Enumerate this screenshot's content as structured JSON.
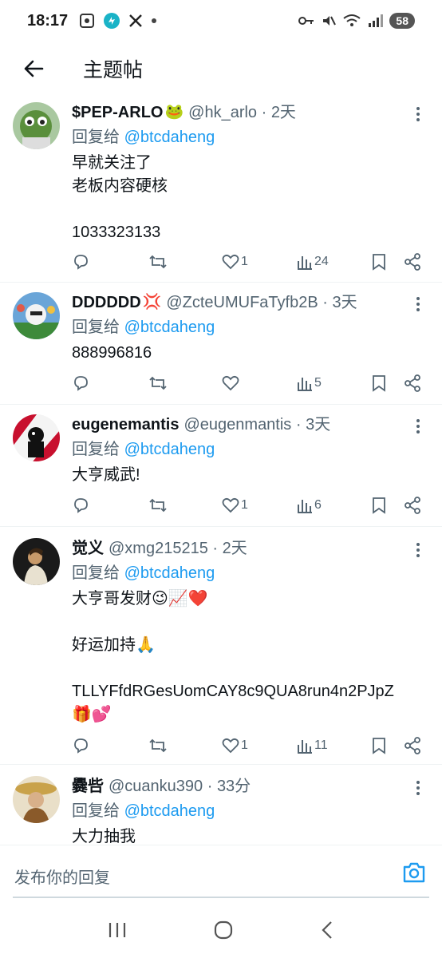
{
  "status_bar": {
    "time": "18:17",
    "battery": "58"
  },
  "app_bar": {
    "title": "主题帖"
  },
  "tweets": [
    {
      "name": "$PEP-ARLO",
      "emoji": "🐸",
      "meta": "@hk_arlo · 2天",
      "reply_prefix": "回复给",
      "reply_mention": "@btcdaheng",
      "body": "早就关注了\n老板内容硬核\n\n1033323133",
      "likes": "1",
      "views": "24"
    },
    {
      "name": "DDDDDD",
      "emoji": "💢",
      "meta": "@ZcteUMUFaTyfb2B · 3天",
      "reply_prefix": "回复给",
      "reply_mention": "@btcdaheng",
      "body": "888996816",
      "likes": "",
      "views": "5"
    },
    {
      "name": "eugenemantis",
      "emoji": "",
      "meta": "@eugenmantis · 3天",
      "reply_prefix": "回复给",
      "reply_mention": "@btcdaheng",
      "body": "大亨威武!",
      "likes": "1",
      "views": "6"
    },
    {
      "name": "觉义",
      "emoji": "",
      "meta": "@xmg215215 · 2天",
      "reply_prefix": "回复给",
      "reply_mention": "@btcdaheng",
      "body": "大亨哥发财😉📈❤️\n\n好运加持🙏\n\nTLLYFfdRGesUomCAY8c9QUA8run4n2PJpZ\n🎁💕",
      "likes": "1",
      "views": "11"
    },
    {
      "name": "爨呰",
      "emoji": "",
      "meta": "@cuanku390 · 33分",
      "reply_prefix": "回复给",
      "reply_mention": "@btcdaheng",
      "body": "大力抽我",
      "likes": "",
      "views": ""
    }
  ],
  "compose": {
    "placeholder": "发布你的回复"
  },
  "colors": {
    "accent": "#1d9bf0",
    "muted": "#536471",
    "text": "#0f1419"
  }
}
